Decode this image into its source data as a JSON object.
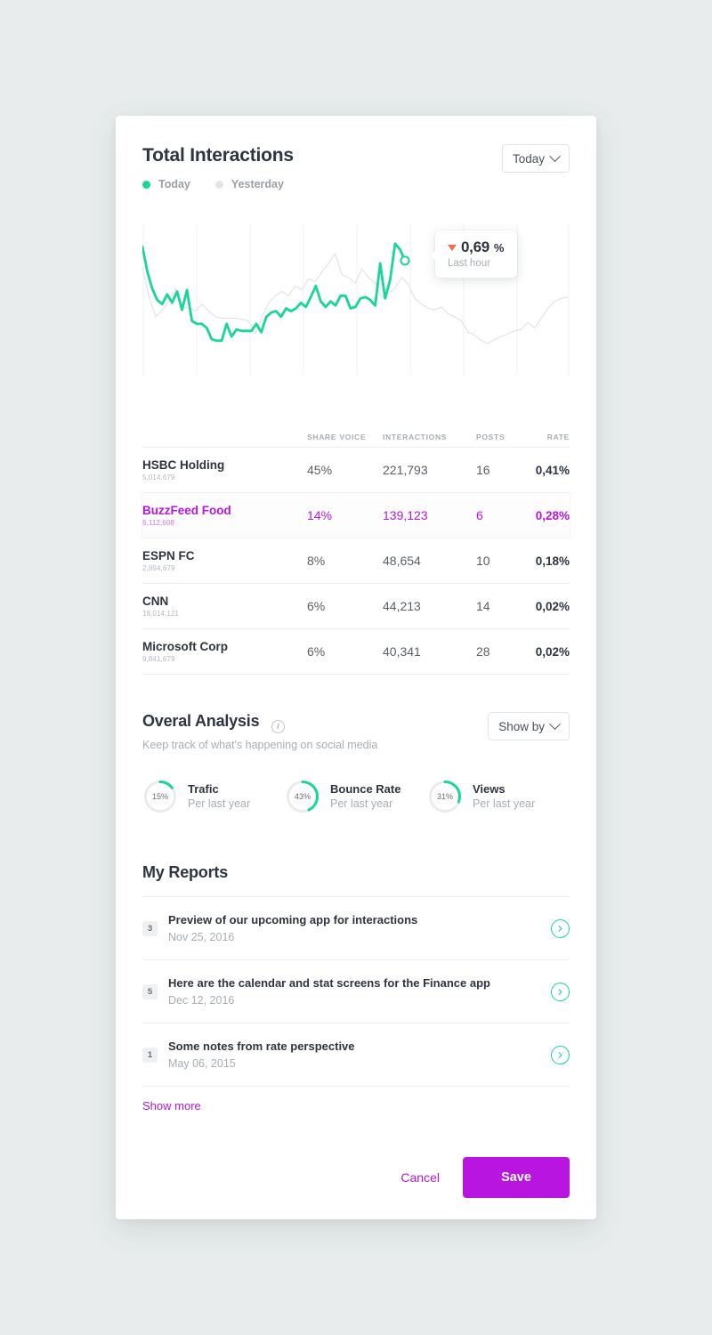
{
  "colors": {
    "accent_green": "#18d69a",
    "accent_purple": "#b816e0",
    "muted_gray": "#d8dadd",
    "tooltip_arrow": "#f26c4f",
    "page_bg": "#e8ecec"
  },
  "header": {
    "title": "Total Interactions",
    "range_dropdown": "Today"
  },
  "legend": [
    {
      "label": "Today",
      "color": "#18d69a"
    },
    {
      "label": "Yesterday",
      "color": "#e3e5e7"
    }
  ],
  "tooltip": {
    "direction_icon": "triangle-down-icon",
    "value": "0,69",
    "unit": "%",
    "sub": "Last hour"
  },
  "table": {
    "headers": [
      "",
      "SHARE VOICE",
      "INTERACTIONS",
      "POSTS",
      "RATE"
    ],
    "rows": [
      {
        "name": "HSBC Holding",
        "followers": "5,014,679",
        "share": "45%",
        "interactions": "221,793",
        "posts": "16",
        "rate": "0,41%",
        "highlight": false
      },
      {
        "name": "BuzzFeed Food",
        "followers": "6,112,608",
        "share": "14%",
        "interactions": "139,123",
        "posts": "6",
        "rate": "0,28%",
        "highlight": true
      },
      {
        "name": "ESPN FC",
        "followers": "2,894,679",
        "share": "8%",
        "interactions": "48,654",
        "posts": "10",
        "rate": "0,18%",
        "highlight": false
      },
      {
        "name": "CNN",
        "followers": "18,014,121",
        "share": "6%",
        "interactions": "44,213",
        "posts": "14",
        "rate": "0,02%",
        "highlight": false
      },
      {
        "name": "Microsoft Corp",
        "followers": "9,841,679",
        "share": "6%",
        "interactions": "40,341",
        "posts": "28",
        "rate": "0,02%",
        "highlight": false
      }
    ]
  },
  "overall_analysis": {
    "title": "Overal Analysis",
    "info_icon": "info-icon",
    "subtitle": "Keep track of what's happening on social media",
    "show_by_dropdown": "Show by",
    "metrics": [
      {
        "percent": "15%",
        "value": 15,
        "name": "Trafic",
        "meta": "Per last year"
      },
      {
        "percent": "43%",
        "value": 43,
        "name": "Bounce Rate",
        "meta": "Per last year"
      },
      {
        "percent": "31%",
        "value": 31,
        "name": "Views",
        "meta": "Per last year"
      }
    ]
  },
  "reports": {
    "title": "My Reports",
    "items": [
      {
        "count": "3",
        "title": "Preview of our upcoming app for interactions",
        "date": "Nov 25, 2016"
      },
      {
        "count": "5",
        "title": "Here are the calendar and stat screens for the Finance app",
        "date": "Dec 12, 2016"
      },
      {
        "count": "1",
        "title": "Some notes from rate perspective",
        "date": "May 06, 2015"
      }
    ],
    "show_more": "Show more"
  },
  "footer": {
    "cancel_label": "Cancel",
    "save_label": "Save"
  },
  "chart_data": {
    "type": "line",
    "title": "Total Interactions",
    "xlabel": "",
    "ylabel": "",
    "grid": "vertical",
    "legend_position": "top-left",
    "xlim": [
      0,
      60
    ],
    "ylim": [
      0,
      100
    ],
    "series": [
      {
        "name": "Today",
        "color": "#18d69a",
        "values": [
          88,
          70,
          58,
          50,
          47,
          54,
          48,
          56,
          43,
          57,
          35,
          33,
          33,
          30,
          22,
          21,
          21,
          33,
          24,
          29,
          28,
          28,
          28,
          33,
          27,
          38,
          41,
          42,
          38,
          44,
          42,
          44,
          48,
          45,
          52,
          60,
          49,
          45,
          49,
          46,
          53,
          53,
          44,
          45,
          51,
          52,
          50,
          46,
          76,
          51,
          64,
          90,
          86,
          78
        ]
      },
      {
        "name": "Yesterday",
        "color": "#e0e2e4",
        "values": [
          73,
          52,
          38,
          43,
          49,
          58,
          44,
          45,
          42,
          47,
          42,
          38,
          37,
          37,
          37,
          36,
          35,
          26,
          38,
          48,
          53,
          56,
          53,
          60,
          57,
          65,
          63,
          70,
          76,
          83,
          68,
          66,
          62,
          72,
          66,
          62,
          52,
          55,
          58,
          66,
          61,
          51,
          47,
          44,
          43,
          45,
          40,
          38,
          35,
          27,
          25,
          21,
          19,
          22,
          24,
          26,
          28,
          29,
          34,
          30,
          37,
          44,
          49,
          51,
          52
        ]
      }
    ],
    "annotation": {
      "label": "Last hour",
      "value": "0,69%",
      "direction": "down"
    }
  }
}
